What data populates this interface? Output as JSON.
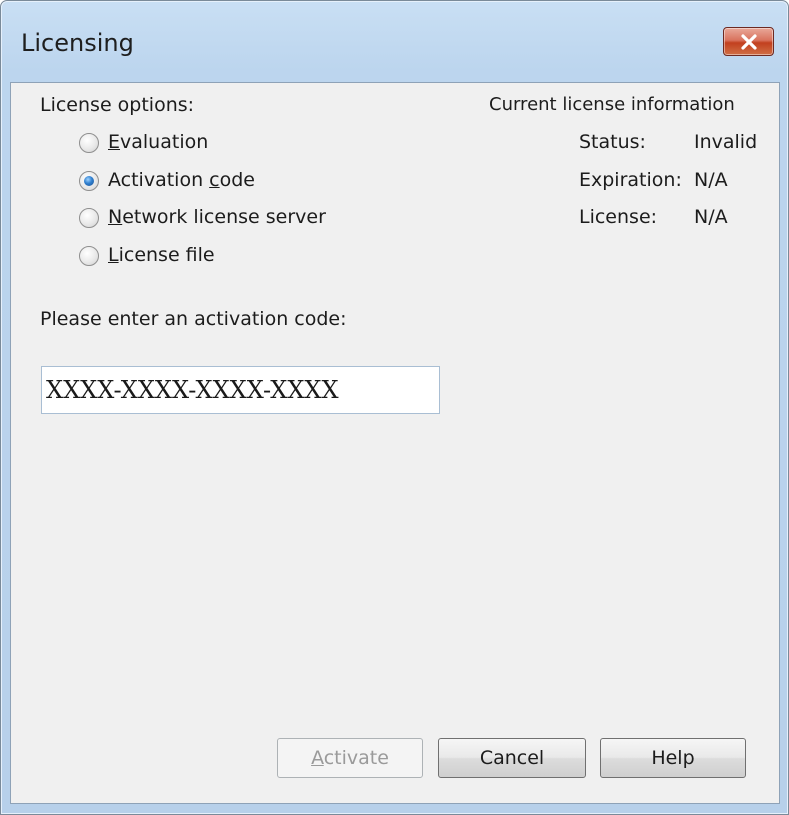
{
  "window": {
    "title": "Licensing",
    "close_icon": "close-icon"
  },
  "options": {
    "heading": "License options:",
    "items": [
      {
        "pre": "",
        "key": "E",
        "post": "valuation",
        "checked": false
      },
      {
        "pre": "Activation ",
        "key": "c",
        "post": "ode",
        "checked": true
      },
      {
        "pre": "",
        "key": "N",
        "post": "etwork license server",
        "checked": false
      },
      {
        "pre": "",
        "key": "L",
        "post": "icense file",
        "checked": false
      }
    ]
  },
  "info": {
    "heading": "Current license information",
    "status_label": "Status:",
    "status_value": "Invalid",
    "expiration_label": "Expiration:",
    "expiration_value": "N/A",
    "license_label": "License:",
    "license_value": "N/A"
  },
  "activation": {
    "prompt": "Please enter an activation code:",
    "code_value": "XXXX-XXXX-XXXX-XXXX"
  },
  "buttons": {
    "activate_key": "A",
    "activate_rest": "ctivate",
    "cancel": "Cancel",
    "help": "Help"
  }
}
